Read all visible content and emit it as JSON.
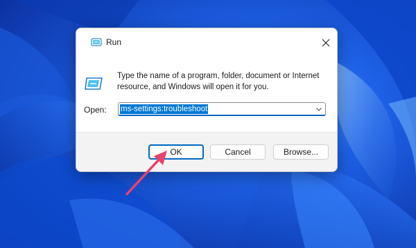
{
  "dialog": {
    "title": "Run",
    "description": "Type the name of a program, folder, document or Internet resource, and Windows will open it for you.",
    "open_label": "Open:",
    "open_value": "ms-settings:troubleshoot",
    "buttons": {
      "ok": "OK",
      "cancel": "Cancel",
      "browse": "Browse..."
    }
  },
  "colors": {
    "accent": "#0067c0",
    "selection": "#0078d4",
    "annotation_arrow": "#e8416b",
    "wallpaper": "#0b3fb8"
  },
  "icons": {
    "title": "run-icon",
    "close": "close-icon",
    "dropdown": "chevron-down-icon",
    "annotation": "pointer-arrow"
  }
}
